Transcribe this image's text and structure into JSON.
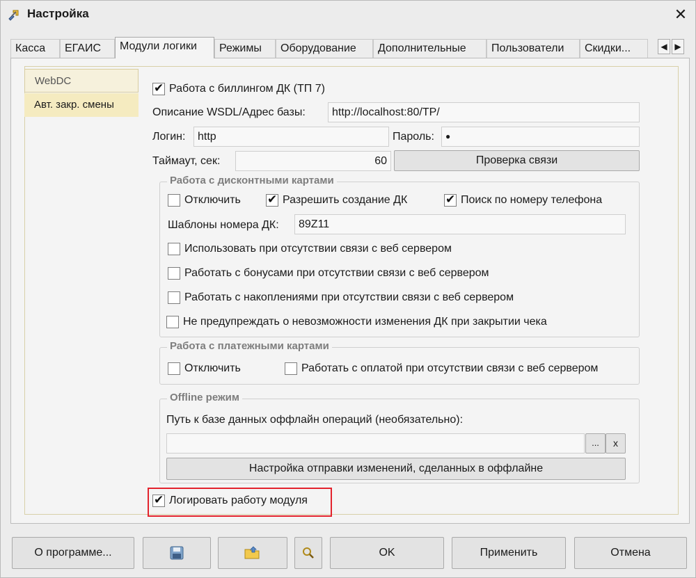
{
  "window": {
    "title": "Настройка"
  },
  "tabs": [
    "Касса",
    "ЕГАИС",
    "Модули логики",
    "Режимы",
    "Оборудование",
    "Дополнительные",
    "Пользователи",
    "Скидки..."
  ],
  "side_items": [
    "WebDC",
    "Авт. закр. смены"
  ],
  "billing": {
    "label": "Работа с биллингом ДК (ТП 7)",
    "checked": true
  },
  "wsdl": {
    "label": "Описание WSDL/Адрес базы:",
    "value": "http://localhost:80/TP/"
  },
  "login": {
    "label": "Логин:",
    "value": "http"
  },
  "password": {
    "label": "Пароль:",
    "value": "●"
  },
  "timeout": {
    "label": "Таймаут, сек:",
    "value": "60"
  },
  "check_button": "Проверка связи",
  "discount_group": {
    "title": "Работа с дисконтными картами",
    "disable": "Отключить",
    "allow_create": "Разрешить создание ДК",
    "phone_search": "Поиск по номеру телефона",
    "template_label": "Шаблоны номера ДК:",
    "template_value": "89Z11",
    "offline_use": "Использовать при отсутствии связи с веб сервером",
    "bonus_offline": "Работать с бонусами при отсутствии связи с веб сервером",
    "accum_offline": "Работать с накоплениями при отсутствии связи с веб сервером",
    "no_warn": "Не предупреждать о невозможности изменения ДК при закрытии чека"
  },
  "payment_group": {
    "title": "Работа с платежными картами",
    "disable": "Отключить",
    "pay_offline": "Работать с оплатой при отсутствии связи с веб сервером"
  },
  "offline_group": {
    "title": "Offline режим",
    "path_label": "Путь к базе данных оффлайн операций (необязательно):",
    "path_value": "",
    "browse": "...",
    "clear": "x",
    "sync_button": "Настройка отправки изменений, сделанных в оффлайне"
  },
  "log_module": {
    "label": "Логировать работу модуля",
    "checked": true
  },
  "bottom": {
    "about": "О программе...",
    "ok": "OK",
    "apply": "Применить",
    "cancel": "Отмена"
  },
  "colors": {
    "highlight": "#e3232d",
    "side_active_bg": "#f5ebc0"
  }
}
